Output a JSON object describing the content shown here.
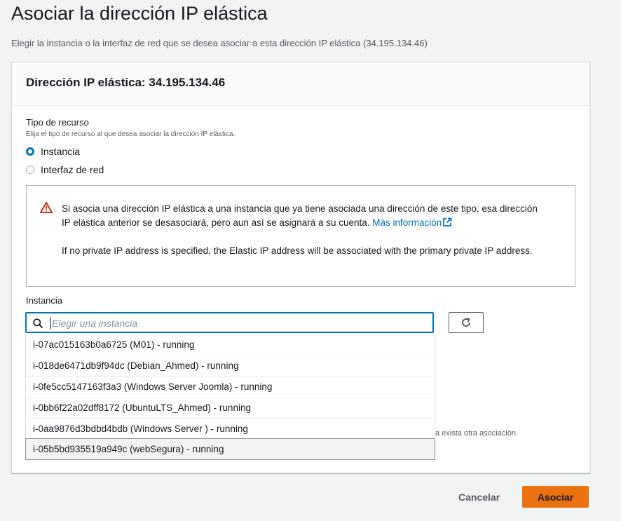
{
  "page": {
    "title": "Asociar la dirección IP elástica",
    "subtitle": "Elegir la instancia o la interfaz de red que se desea asociar a esta dirección IP elástica (34.195.134.46)"
  },
  "panel": {
    "header": "Dirección IP elástica: 34.195.134.46",
    "resource_type": {
      "label": "Tipo de recurso",
      "description": "Elija el tipo de recurso al que desea asociar la dirección IP elástica.",
      "options": [
        {
          "label": "Instancia",
          "checked": true
        },
        {
          "label": "Interfaz de red",
          "checked": false
        }
      ]
    },
    "alert": {
      "text_part1": "Si asocia una dirección IP elástica a una instancia que ya tiene asociada una dirección de este tipo, esa dirección IP elástica anterior se desasociará, pero aun así se asignará a su cuenta.",
      "link": "Más información",
      "text_part2": "If no private IP address is specified, the Elastic IP address will be associated with the primary private IP address.",
      "warning_color": "#d13212"
    },
    "instance": {
      "label": "Instancia",
      "placeholder": "Elegir una instancia",
      "value": "",
      "options": [
        "i-07ac015163b0a6725 (M01) - running",
        "i-018de6471db9f94dc (Debian_Ahmed) - running",
        "i-0fe5cc5147163f3a3 (Windows Server Joomla) - running",
        "i-0bb6f22a02dff8172 (UbuntuLTS_Ahmed) - running",
        "i-0aa9876d3bdbd4bdb (Windows Server ) - running",
        "i-05b5bd935519a949c (webSegura) - running"
      ],
      "hovered_index": 5
    },
    "partial_text": "a exista otra asociación."
  },
  "footer": {
    "cancel": "Cancelar",
    "submit": "Asociar",
    "submit_color": "#ec7211"
  }
}
